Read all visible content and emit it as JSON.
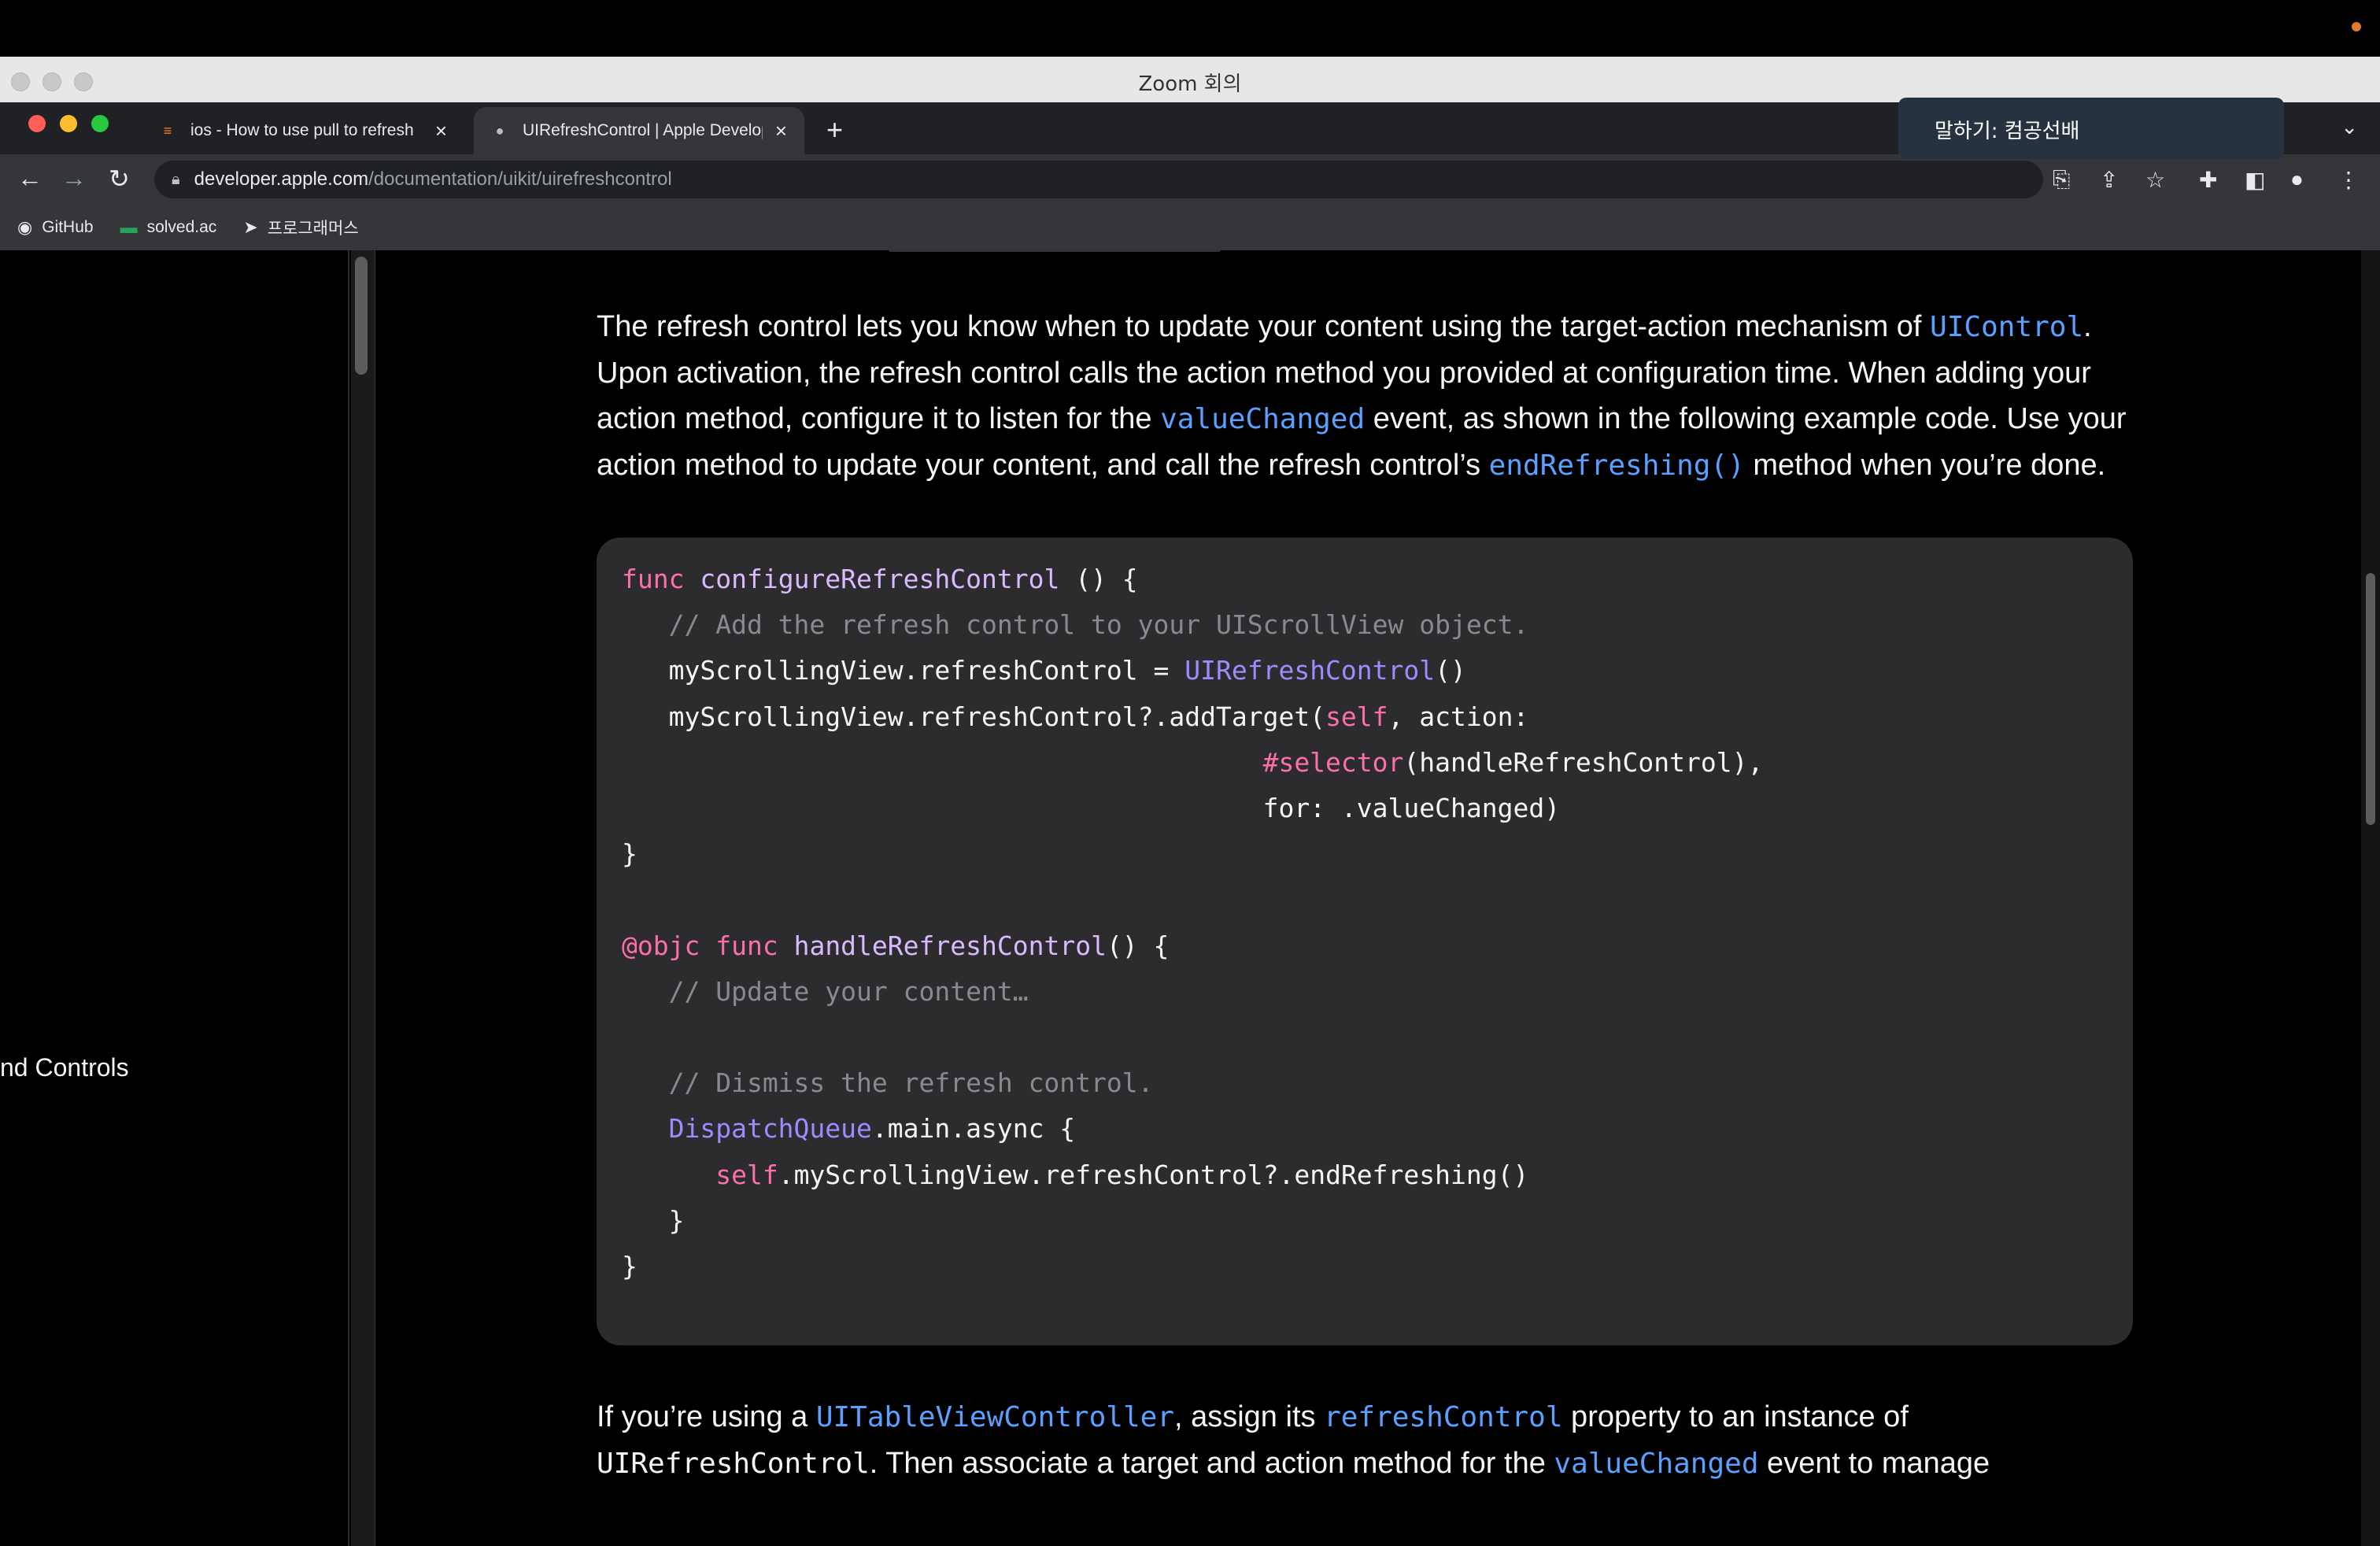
{
  "zoom": {
    "window_title": "Zoom 회의",
    "speaker_label": "말하기: 컴공선배"
  },
  "browser": {
    "tabs": [
      {
        "title": "ios - How to use pull to refresh",
        "favicon": "stack-overflow-icon"
      },
      {
        "title": "UIRefreshControl | Apple Developer",
        "favicon": "apple-icon"
      }
    ],
    "url_host": "developer.apple.com",
    "url_path": "/documentation/uikit/uirefreshcontrol",
    "bookmarks": [
      {
        "label": "GitHub",
        "icon": "github-icon"
      },
      {
        "label": "solved.ac",
        "icon": "solvedac-icon"
      },
      {
        "label": "프로그래머스",
        "icon": "programmers-icon"
      }
    ]
  },
  "sidebar": {
    "visible_item": "nd Controls"
  },
  "article": {
    "para1": {
      "t1": "The refresh control lets you know when to update your content using the target-action mechanism of ",
      "l1": "UIControl",
      "t2": ". Upon activation, the refresh control calls the action method you provided at configuration time. When adding your action method, configure it to listen for the ",
      "l2": "valueChanged",
      "t3": " event, as shown in the following example code. Use your action method to update your content, and call the refresh control’s ",
      "l3": "endRefreshing()",
      "t4": " method when you’re done."
    },
    "code": {
      "l1_kw": "func",
      "l1_fn": "configureRefreshControl",
      "l1_rest": " () {",
      "l2_cm": "// Add the refresh control to your UIScrollView object.",
      "l3_a": "myScrollingView.refreshControl = ",
      "l3_ty": "UIRefreshControl",
      "l3_b": "()",
      "l4_a": "myScrollingView.refreshControl?.addTarget(",
      "l4_kw": "self",
      "l4_b": ", action:",
      "l5_kw": "#selector",
      "l5_b": "(handleRefreshControl),",
      "l6": "for: .valueChanged)",
      "l7": "}",
      "l9_at": "@objc",
      "l9_kw": "func",
      "l9_fn": "handleRefreshControl",
      "l9_rest": "() {",
      "l10_cm": "// Update your content…",
      "l12_cm": "// Dismiss the refresh control.",
      "l13_ty": "DispatchQueue",
      "l13_rest": ".main.async {",
      "l14_kw": "self",
      "l14_rest": ".myScrollingView.refreshControl?.endRefreshing()",
      "l15": "}",
      "l16": "}"
    },
    "para2": {
      "t1": "If you’re using a ",
      "l1": "UITableViewController",
      "t2": ", assign its ",
      "l2": "refreshControl",
      "t3": " property to an instance of ",
      "c1": "UIRefreshControl",
      "t4": ". Then associate a target and action method for the ",
      "l3": "valueChanged",
      "t5": " event to manage"
    }
  }
}
